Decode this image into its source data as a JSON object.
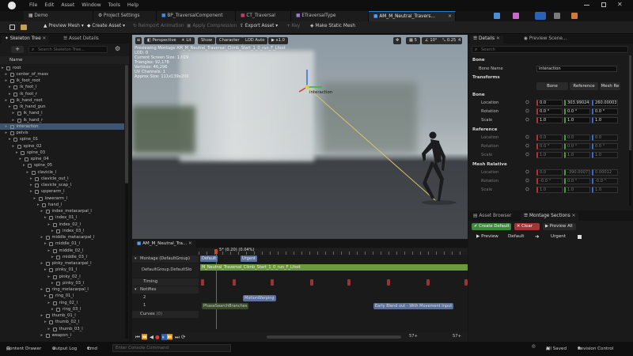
{
  "titlebar": {
    "menus": [
      "File",
      "Edit",
      "Asset",
      "Window",
      "Tools",
      "Help"
    ],
    "tabs": [
      {
        "label": "Demo",
        "active": false
      },
      {
        "label": "Project Settings",
        "active": false
      },
      {
        "label": "BP_TraversalComponent",
        "active": false
      },
      {
        "label": "CT_Traversal",
        "active": false
      },
      {
        "label": "ETraversalType",
        "active": false
      },
      {
        "label": "AM_M_Neutral_Travers...",
        "active": true
      }
    ]
  },
  "toolbar": {
    "preview_mesh": "Preview Mesh",
    "create_asset": "Create Asset",
    "reimport": "Reimport Animation",
    "apply_compression": "Apply Compression",
    "export_asset": "Export Asset",
    "key": "Key",
    "make_static_mesh": "Make Static Mesh"
  },
  "left": {
    "tabs": [
      "Skeleton Tree",
      "Asset Details"
    ],
    "search_placeholder": "Search Skeleton Tree...",
    "column_name": "Name",
    "bones": [
      {
        "name": "root",
        "depth": 0
      },
      {
        "name": "center_of_mass",
        "depth": 1
      },
      {
        "name": "ik_foot_root",
        "depth": 1
      },
      {
        "name": "ik_foot_l",
        "depth": 2
      },
      {
        "name": "ik_foot_r",
        "depth": 2
      },
      {
        "name": "ik_hand_root",
        "depth": 1
      },
      {
        "name": "ik_hand_gun",
        "depth": 2
      },
      {
        "name": "ik_hand_l",
        "depth": 3
      },
      {
        "name": "ik_hand_r",
        "depth": 3
      },
      {
        "name": "interaction",
        "depth": 1,
        "selected": true
      },
      {
        "name": "pelvis",
        "depth": 1
      },
      {
        "name": "spine_01",
        "depth": 2
      },
      {
        "name": "spine_02",
        "depth": 3
      },
      {
        "name": "spine_03",
        "depth": 4
      },
      {
        "name": "spine_04",
        "depth": 5
      },
      {
        "name": "spine_05",
        "depth": 6
      },
      {
        "name": "clavicle_l",
        "depth": 7
      },
      {
        "name": "clavicle_out_l",
        "depth": 8
      },
      {
        "name": "clavicle_scap_l",
        "depth": 8
      },
      {
        "name": "upperarm_l",
        "depth": 8
      },
      {
        "name": "lowerarm_l",
        "depth": 9
      },
      {
        "name": "hand_l",
        "depth": 10
      },
      {
        "name": "index_metacarpal_l",
        "depth": 11
      },
      {
        "name": "index_01_l",
        "depth": 12
      },
      {
        "name": "index_02_l",
        "depth": 13
      },
      {
        "name": "index_03_l",
        "depth": 14
      },
      {
        "name": "middle_metacarpal_l",
        "depth": 11
      },
      {
        "name": "middle_01_l",
        "depth": 12
      },
      {
        "name": "middle_02_l",
        "depth": 13
      },
      {
        "name": "middle_03_l",
        "depth": 14
      },
      {
        "name": "pinky_metacarpal_l",
        "depth": 11
      },
      {
        "name": "pinky_01_l",
        "depth": 12
      },
      {
        "name": "pinky_02_l",
        "depth": 13
      },
      {
        "name": "pinky_03_l",
        "depth": 14
      },
      {
        "name": "ring_metacarpal_l",
        "depth": 11
      },
      {
        "name": "ring_01_l",
        "depth": 12
      },
      {
        "name": "ring_02_l",
        "depth": 13
      },
      {
        "name": "ring_03_l",
        "depth": 14
      },
      {
        "name": "thumb_01_l",
        "depth": 11
      },
      {
        "name": "thumb_02_l",
        "depth": 12
      },
      {
        "name": "thumb_03_l",
        "depth": 13
      },
      {
        "name": "weapon_l",
        "depth": 11
      }
    ]
  },
  "viewport": {
    "buttons": [
      "Perspective",
      "Lit",
      "Show",
      "Character",
      "LOD Auto",
      "x1.0"
    ],
    "right_buttons": [
      "5",
      "10°",
      "0.25",
      "4"
    ],
    "info": [
      "Previewing Montage AM_M_Neutral_Traversal_Climb_Start_1_0_run_F_Lfoot",
      "LOD: 0",
      "Current Screen Size: 1.029",
      "Triangles: 92,178",
      "Vertices: 46,296",
      "UV Channels: 1",
      "Approx Size: 111x139x200"
    ],
    "gizmo_label": "interaction"
  },
  "details": {
    "tabs": [
      "Details",
      "Preview Scene..."
    ],
    "search_placeholder": "Search",
    "sections": {
      "bone": "Bone",
      "transforms": "Transforms",
      "bone2": "Bone",
      "reference": "Reference",
      "mesh_relative": "Mesh Relative"
    },
    "bone_name_label": "Bone Name",
    "bone_name_value": "interaction",
    "space_buttons": [
      "Bone",
      "Reference",
      "Mesh Re"
    ],
    "bone_rows": [
      {
        "label": "Location",
        "values": [
          "0.0",
          "303.99024",
          "260.00003"
        ]
      },
      {
        "label": "Rotation",
        "values": [
          "0.0 °",
          "0.0 °",
          "0.0 °"
        ]
      },
      {
        "label": "Scale",
        "values": [
          "1.0",
          "1.0",
          "1.0"
        ]
      }
    ],
    "reference_rows": [
      {
        "label": "Location",
        "values": [
          "0.0",
          "0.0",
          "0.0"
        ]
      },
      {
        "label": "Rotation",
        "values": [
          "0.0 °",
          "0.0 °",
          "0.0 °"
        ]
      },
      {
        "label": "Scale",
        "values": [
          "1.0",
          "1.0",
          "1.0"
        ]
      }
    ],
    "mesh_rows": [
      {
        "label": "Location",
        "values": [
          "0.0",
          "-390.00073",
          "0.00012"
        ]
      },
      {
        "label": "Rotation",
        "values": [
          "-0.0 °",
          "0.0 °",
          "-0.0 °"
        ]
      },
      {
        "label": "Scale",
        "values": [
          "1.0",
          "1.0",
          "1.0"
        ]
      }
    ]
  },
  "asset_browser": {
    "tabs": [
      "Asset Browser",
      "Montage Sections"
    ],
    "create_default": "Create Default",
    "clear": "Clear",
    "preview_all": "Preview All",
    "preview": "Preview",
    "default": "Default",
    "urgent": "Urgent"
  },
  "timeline": {
    "tab": "AM_M_Neutral_Tra...",
    "frame_readout": "5* (0.20) (0.04%)",
    "montage_label": "Montage (DefaultGroup)",
    "group_label": "DefaultGroup.DefaultSlo",
    "timing": "Timing",
    "notifies": "Notifies",
    "track_nums": [
      "2",
      "1"
    ],
    "curves": "Curves",
    "curves_count": "(0)",
    "section_default": "Default",
    "section_urgent": "Urgent",
    "segment_label": "M_Neutral_Traversal_Climb_Start_1_0_run_F_Lfoot",
    "notify_motionwarping": "MotionWarping",
    "notify_phasesearch": "PhaseSearchBranches",
    "notify_earlyblend": "Early Blend out - With Movement Input",
    "tick_labels": [
      "0",
      "+",
      "+",
      "-"
    ],
    "range_labels": [
      "57+",
      "57+"
    ]
  },
  "footer": {
    "content_drawer": "Content Drawer",
    "output_log": "Output Log",
    "cmd": "Cmd",
    "console_placeholder": "Enter Console Command",
    "all_saved": "All Saved",
    "revision_control": "Revision Control"
  }
}
